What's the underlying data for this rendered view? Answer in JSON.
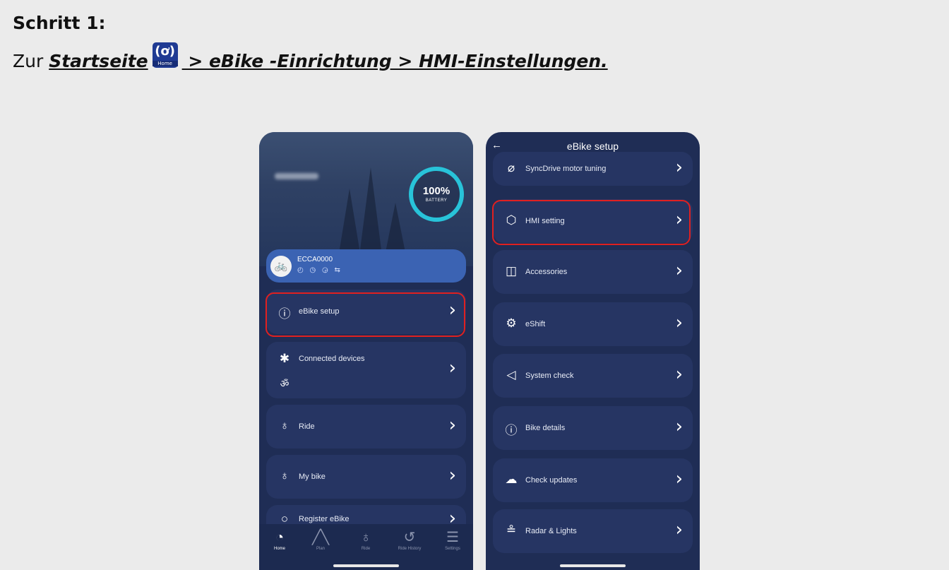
{
  "step_heading": "Schritt 1:",
  "instruction": {
    "prefix": "Zur ",
    "link_start": "Startseite",
    "icon_label": "Home",
    "link_rest": " > eBike -Einrichtung > HMI-Einstellungen."
  },
  "left_screen": {
    "battery_percent": "100%",
    "battery_label": "BATTERY",
    "bike_name": "ECCA0000",
    "bike_status_icons": [
      "gauge-icon",
      "clock-icon",
      "speed-icon",
      "shift-icon"
    ],
    "menu": [
      {
        "label": "eBike setup",
        "icon": "info-icon"
      },
      {
        "label": "Connected devices",
        "icon": "bluetooth-icon"
      },
      {
        "label": "Ride",
        "icon": "cyclist-icon"
      },
      {
        "label": "My bike",
        "icon": "bicycle-icon"
      },
      {
        "label": "Register eBike",
        "icon": "pin-icon"
      }
    ],
    "tabs": [
      {
        "label": "Home",
        "icon": "speedometer-icon",
        "active": true
      },
      {
        "label": "Plan",
        "icon": "road-icon",
        "active": false
      },
      {
        "label": "Ride",
        "icon": "cyclist-icon",
        "active": false
      },
      {
        "label": "Ride History",
        "icon": "history-icon",
        "active": false
      },
      {
        "label": "Settings",
        "icon": "sliders-icon",
        "active": false
      }
    ]
  },
  "right_screen": {
    "title": "eBike setup",
    "menu": [
      {
        "label": "SyncDrive motor tuning",
        "icon": "motor-icon"
      },
      {
        "label": "HMI setting",
        "icon": "hex-nut-icon"
      },
      {
        "label": "Accessories",
        "icon": "lamp-icon"
      },
      {
        "label": "eShift",
        "icon": "gear-shift-icon"
      },
      {
        "label": "System check",
        "icon": "send-icon"
      },
      {
        "label": "Bike details",
        "icon": "info-icon"
      },
      {
        "label": "Check updates",
        "icon": "cloud-icon"
      },
      {
        "label": "Radar & Lights",
        "icon": "radar-icon"
      }
    ]
  },
  "colors": {
    "background": "#ebebeb",
    "phone_bg": "#1f2d55",
    "card_bg": "#263563",
    "bike_card": "#3b63b3",
    "battery_ring": "#28c3d9",
    "highlight": "#e02020"
  }
}
